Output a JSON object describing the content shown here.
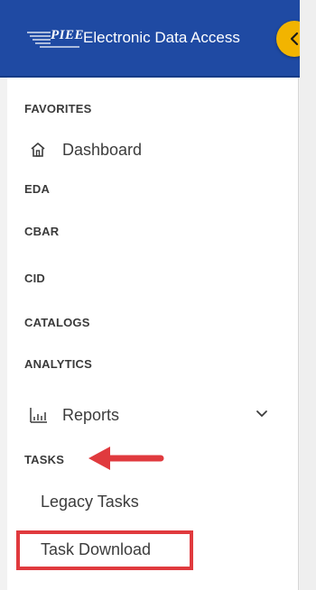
{
  "header": {
    "logo_text": "PIEE",
    "title": "Electronic Data Access"
  },
  "sidebar": {
    "favorites_label": "FAVORITES",
    "dashboard_label": "Dashboard",
    "eda_label": "EDA",
    "cbar_label": "CBAR",
    "cid_label": "CID",
    "catalogs_label": "CATALOGS",
    "analytics_label": "ANALYTICS",
    "reports_label": "Reports",
    "tasks_label": "TASKS",
    "legacy_tasks_label": "Legacy Tasks",
    "task_download_label": "Task Download"
  },
  "icons": {
    "collapse": "chevron-left-icon",
    "dashboard": "home-icon",
    "reports": "bar-chart-icon",
    "reports_expand": "chevron-down-icon"
  },
  "colors": {
    "header_blue": "#1f4aa3",
    "collapse_yellow": "#f2b400",
    "annotation_red": "#e03a3e"
  }
}
